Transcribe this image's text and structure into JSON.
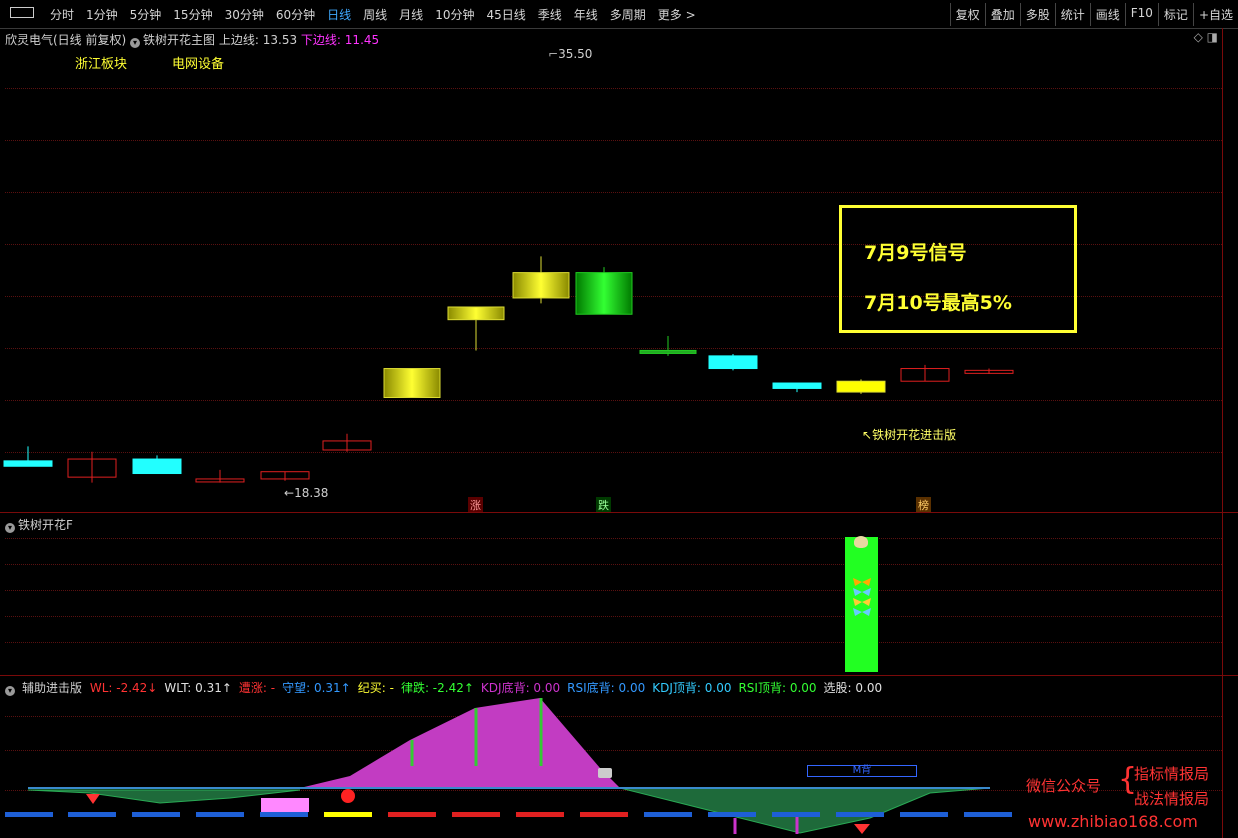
{
  "toolbar": {
    "periods": [
      "分时",
      "1分钟",
      "5分钟",
      "15分钟",
      "30分钟",
      "60分钟",
      "日线",
      "周线",
      "月线",
      "10分钟",
      "45日线",
      "季线",
      "年线",
      "多周期",
      "更多 >"
    ],
    "active_period": "日线",
    "actions": [
      "复权",
      "叠加",
      "多股",
      "统计",
      "画线",
      "F10",
      "标记",
      "+自选"
    ]
  },
  "main_pane": {
    "stock_name": "欣灵电气(日线 前复权)",
    "indicator": "铁树开花主图",
    "upper_label": "上边线:",
    "upper_value": "13.53",
    "lower_label": "下边线:",
    "lower_value": "11.45",
    "sectors": [
      "浙江板块",
      "电网设备"
    ],
    "high_marker": "35.50",
    "low_marker": "18.38",
    "signal_label": "铁树开花进击版",
    "callout_line1": "7月9号信号",
    "callout_line2": "7月10号最高5%",
    "badges": {
      "zhang": "涨",
      "die": "跌",
      "bang": "榜"
    }
  },
  "sub_pane1": {
    "title": "铁树开花F"
  },
  "sub_pane2": {
    "title": "辅助进击版",
    "items": [
      {
        "label": "WL:",
        "value": "-2.42↓",
        "color": "#ff3333"
      },
      {
        "label": "WLT:",
        "value": "0.31↑",
        "color": "#e0e0e0"
      },
      {
        "label": "遭涨:",
        "value": "-",
        "color": "#ff3333"
      },
      {
        "label": "守望:",
        "value": "0.31↑",
        "color": "#3399ff"
      },
      {
        "label": "纪买:",
        "value": "-",
        "color": "#ffff33"
      },
      {
        "label": "律跌:",
        "value": "-2.42↑",
        "color": "#33ff33"
      },
      {
        "label": "KDJ底背:",
        "value": "0.00",
        "color": "#cc33cc"
      },
      {
        "label": "RSI底背:",
        "value": "0.00",
        "color": "#3399ff"
      },
      {
        "label": "KDJ顶背:",
        "value": "0.00",
        "color": "#33ccff"
      },
      {
        "label": "RSI顶背:",
        "value": "0.00",
        "color": "#33ff33"
      },
      {
        "label": "选股:",
        "value": "0.00",
        "color": "#e0e0e0"
      }
    ],
    "m_label": "M背"
  },
  "watermark": {
    "wechat": "微信公众号",
    "line1": "指标情报局",
    "line2": "战法情报局",
    "url": "www.zhibiao168.com"
  },
  "candles": [
    {
      "o": 12.2,
      "c": 12.5,
      "h": 13.3,
      "l": 12.2,
      "color": "cyan"
    },
    {
      "o": 12.6,
      "c": 11.6,
      "h": 13.0,
      "l": 11.3,
      "color": "red_hollow"
    },
    {
      "o": 11.8,
      "c": 12.6,
      "h": 12.8,
      "l": 11.8,
      "color": "cyan"
    },
    {
      "o": 11.5,
      "c": 11.4,
      "h": 12.0,
      "l": 11.3,
      "color": "red_hollow"
    },
    {
      "o": 11.5,
      "c": 11.9,
      "h": 11.9,
      "l": 11.4,
      "color": "red_hollow"
    },
    {
      "o": 13.1,
      "c": 13.6,
      "h": 14.0,
      "l": 13.0,
      "color": "red_hollow"
    },
    {
      "o": 16.0,
      "c": 17.6,
      "h": 17.6,
      "l": 16.0,
      "color": "gold"
    },
    {
      "o": 20.3,
      "c": 21.0,
      "h": 21.0,
      "l": 18.6,
      "color": "gold"
    },
    {
      "o": 21.5,
      "c": 22.9,
      "h": 23.8,
      "l": 21.2,
      "color": "gold"
    },
    {
      "o": 22.9,
      "c": 20.6,
      "h": 23.2,
      "l": 20.6,
      "color": "green"
    },
    {
      "o": 18.6,
      "c": 18.5,
      "h": 19.4,
      "l": 18.3,
      "color": "green_line"
    },
    {
      "o": 17.6,
      "c": 18.3,
      "h": 18.4,
      "l": 17.5,
      "color": "cyan"
    },
    {
      "o": 16.5,
      "c": 16.8,
      "h": 16.8,
      "l": 16.3,
      "color": "cyan"
    },
    {
      "o": 16.3,
      "c": 16.9,
      "h": 17.0,
      "l": 16.2,
      "color": "yellow"
    },
    {
      "o": 16.9,
      "c": 17.6,
      "h": 17.8,
      "l": 16.9,
      "color": "red_hollow"
    },
    {
      "o": 17.4,
      "c": 17.5,
      "h": 17.6,
      "l": 17.3,
      "color": "red_hollow"
    }
  ]
}
